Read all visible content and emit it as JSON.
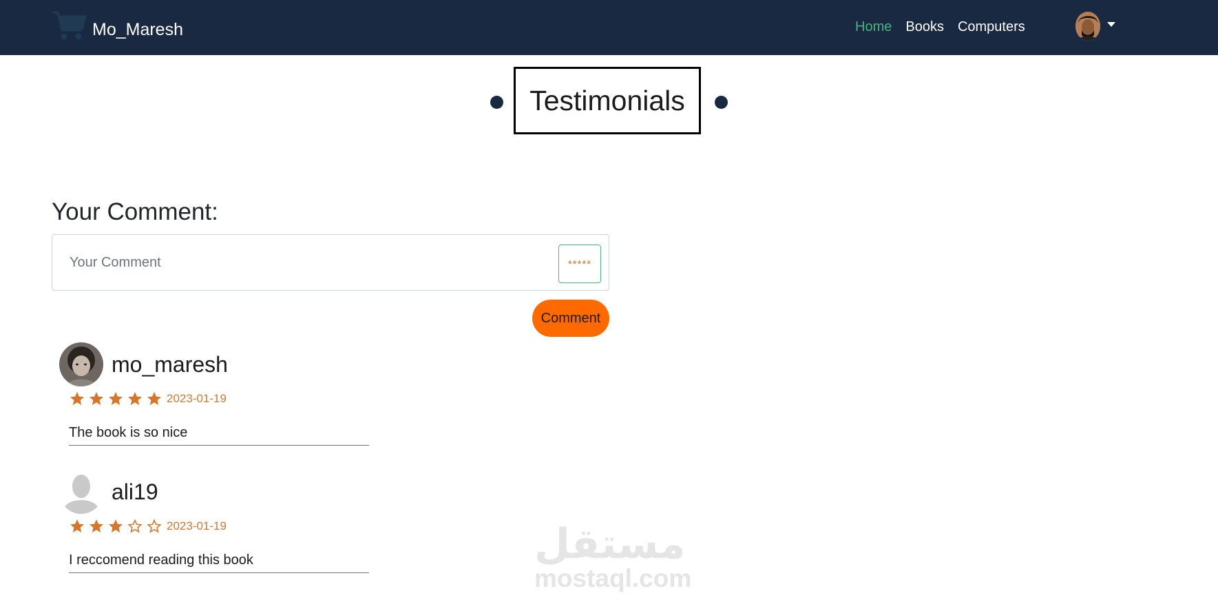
{
  "nav": {
    "brand": "Mo_Maresh",
    "links": [
      {
        "label": "Home",
        "active": true
      },
      {
        "label": "Books",
        "active": false
      },
      {
        "label": "Computers",
        "active": false
      }
    ],
    "accent_color": "#4bb47d",
    "bg_color": "#1a2942"
  },
  "page": {
    "title": "Testimonials"
  },
  "form": {
    "heading": "Your Comment:",
    "placeholder": "Your Comment",
    "value": "",
    "rating_value": "*****",
    "submit_label": "Comment",
    "button_color": "#ff6a00"
  },
  "comments": [
    {
      "username": "mo_maresh",
      "rating": 5,
      "date": "2023-01-19",
      "text": "The book is so nice",
      "avatar": "photo"
    },
    {
      "username": "ali19",
      "rating": 3,
      "date": "2023-01-19",
      "text": "I reccomend reading this book",
      "avatar": "default"
    }
  ],
  "watermark": {
    "arabic": "مستقل",
    "latin": "mostaql.com"
  }
}
